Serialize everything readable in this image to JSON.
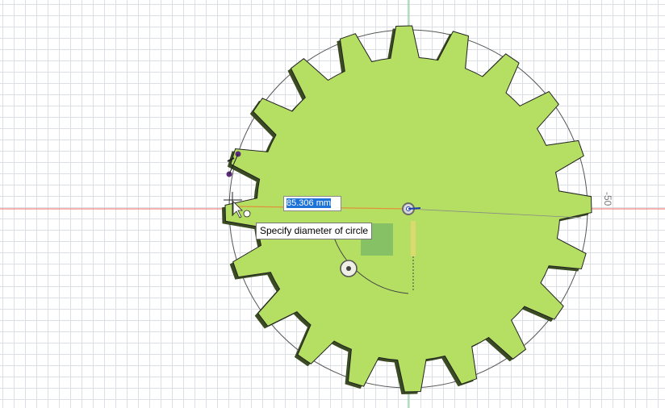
{
  "viewport": {
    "axis_label": "-50"
  },
  "dimension_input": {
    "value": "85.306 mm"
  },
  "tooltip": {
    "text": "Specify diameter of circle"
  },
  "colors": {
    "gear_fill": "#b5df63",
    "gear_shadow": "#3a4a22",
    "x_axis": "#e86a6a",
    "y_axis": "#5fc47a",
    "selection": "#1e73d8",
    "sketch_point": "#5a2d7a"
  },
  "gear": {
    "teeth": 20
  }
}
